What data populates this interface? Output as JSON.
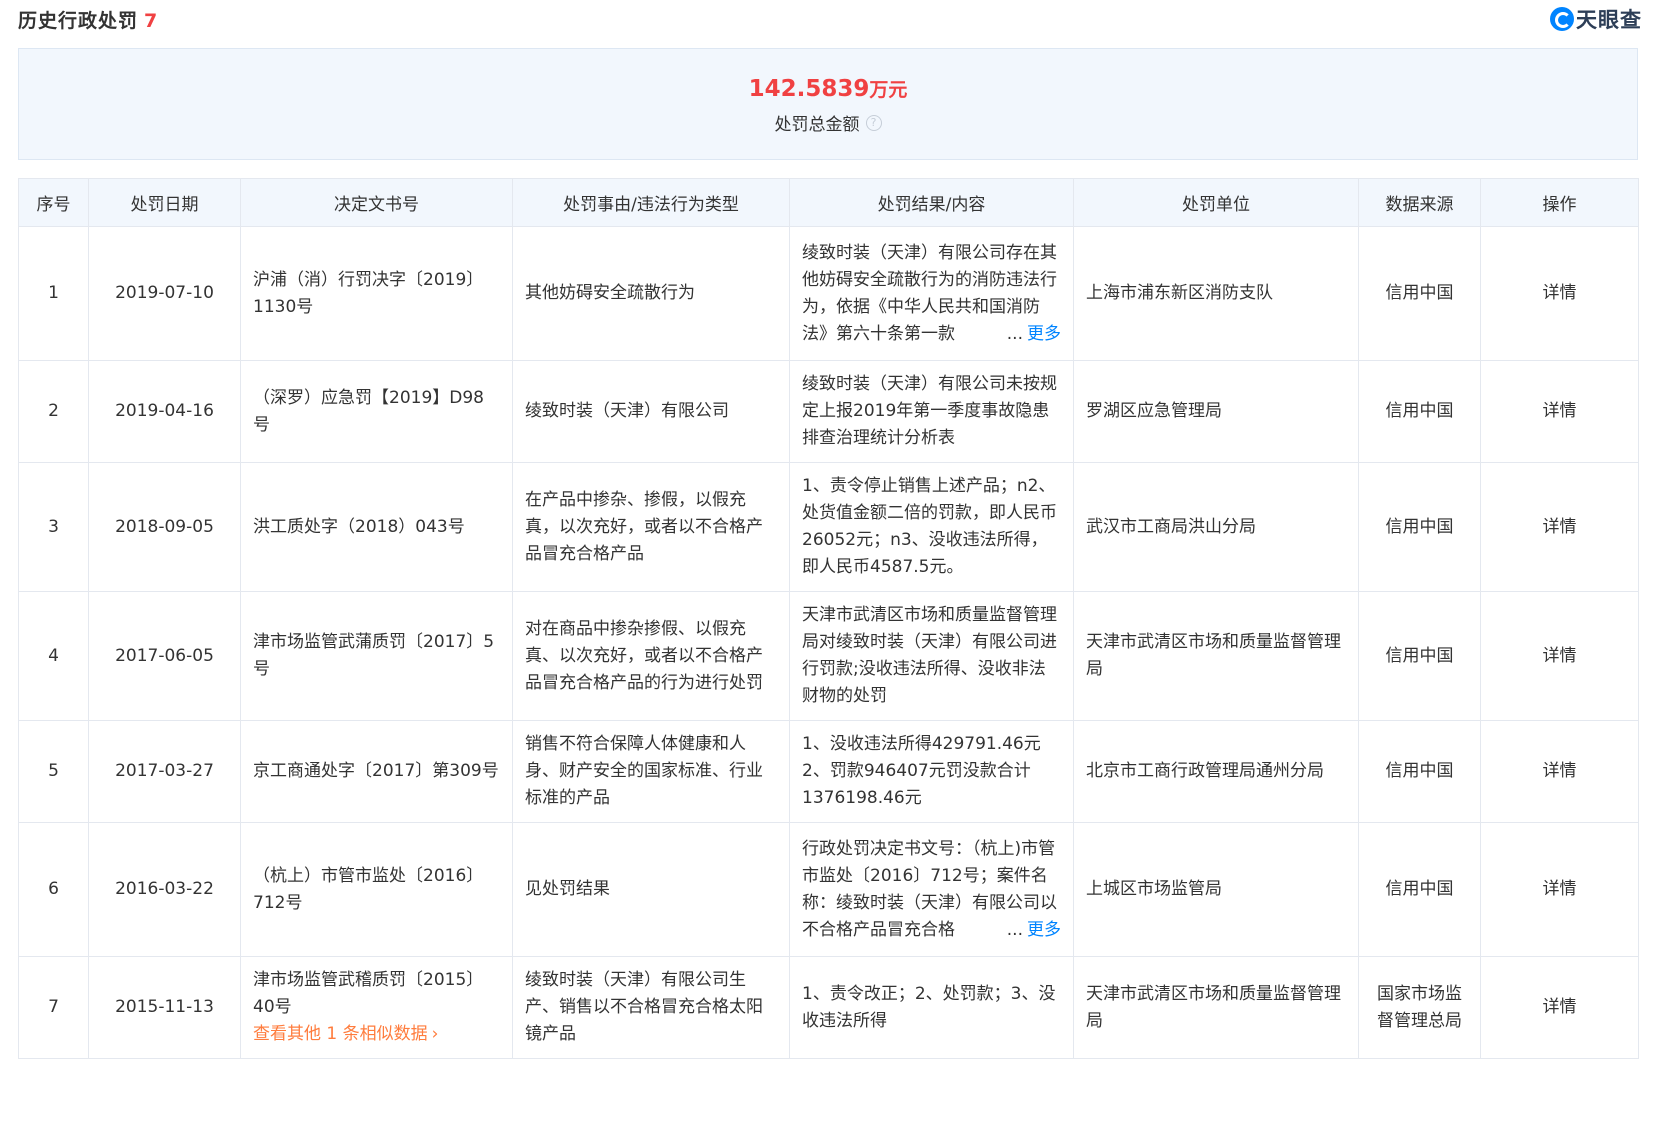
{
  "header": {
    "title": "历史行政处罚",
    "count": "7",
    "logo_text": "天眼查"
  },
  "summary": {
    "amount": "142.5839",
    "unit": "万元",
    "label": "处罚总金额",
    "help_icon": "?"
  },
  "table": {
    "columns": [
      "序号",
      "处罚日期",
      "决定文书号",
      "处罚事由/违法行为类型",
      "处罚结果/内容",
      "处罚单位",
      "数据来源",
      "操作"
    ],
    "rows": [
      {
        "index": "1",
        "date": "2019-07-10",
        "doc": "沪浦（消）行罚决字〔2019〕1130号",
        "reason": "其他妨碍安全疏散行为",
        "result": "绫致时装（天津）有限公司存在其他妨碍安全疏散行为的消防违法行为，依据《中华人民共和国消防法》第六十条第一款",
        "result_more": "更多",
        "org": "上海市浦东新区消防支队",
        "source": "信用中国",
        "action": "详情"
      },
      {
        "index": "2",
        "date": "2019-04-16",
        "doc": "（深罗）应急罚【2019】D98号",
        "reason": "绫致时装（天津）有限公司",
        "result": "绫致时装（天津）有限公司未按规定上报2019年第一季度事故隐患排查治理统计分析表",
        "result_more": "",
        "org": "罗湖区应急管理局",
        "source": "信用中国",
        "action": "详情"
      },
      {
        "index": "3",
        "date": "2018-09-05",
        "doc": "洪工质处字（2018）043号",
        "reason": "在产品中掺杂、掺假，以假充真，以次充好，或者以不合格产品冒充合格产品",
        "result": "1、责令停止销售上述产品；n2、处货值金额二倍的罚款，即人民币26052元；n3、没收违法所得，即人民币4587.5元。",
        "result_more": "",
        "org": "武汉市工商局洪山分局",
        "source": "信用中国",
        "action": "详情"
      },
      {
        "index": "4",
        "date": "2017-06-05",
        "doc": "津市场监管武蒲质罚〔2017〕5号",
        "reason": "对在商品中掺杂掺假、以假充真、以次充好，或者以不合格产品冒充合格产品的行为进行处罚",
        "result": "天津市武清区市场和质量监督管理局对绫致时装（天津）有限公司进行罚款;没收违法所得、没收非法财物的处罚",
        "result_more": "",
        "org": "天津市武清区市场和质量监督管理局",
        "source": "信用中国",
        "action": "详情"
      },
      {
        "index": "5",
        "date": "2017-03-27",
        "doc": "京工商通处字〔2017〕第309号",
        "reason": "销售不符合保障人体健康和人身、财产安全的国家标准、行业标准的产品",
        "result": "1、没收违法所得429791.46元 2、罚款946407元罚没款合计1376198.46元",
        "result_more": "",
        "org": "北京市工商行政管理局通州分局",
        "source": "信用中国",
        "action": "详情"
      },
      {
        "index": "6",
        "date": "2016-03-22",
        "doc": "（杭上）市管市监处〔2016〕712号",
        "reason": "见处罚结果",
        "result": "行政处罚决定书文号：（杭上)市管市监处〔2016〕712号；案件名称：绫致时装（天津）有限公司以不合格产品冒充合格",
        "result_more": "更多",
        "org": "上城区市场监管局",
        "source": "信用中国",
        "action": "详情"
      },
      {
        "index": "7",
        "date": "2015-11-13",
        "doc": "津市场监管武稽质罚〔2015〕40号",
        "doc_similar": "查看其他 1 条相似数据",
        "reason": "绫致时装（天津）有限公司生产、销售以不合格冒充合格太阳镜产品",
        "result": "1、责令改正；2、处罚款；3、没收违法所得",
        "result_more": "",
        "org": "天津市武清区市场和质量监督管理局",
        "source": "国家市场监督管理总局",
        "action": "详情"
      }
    ]
  },
  "icons": {
    "logo": "tianyancha-logo-icon",
    "help": "question-circle-icon",
    "chevron": "chevron-right-icon"
  },
  "colors": {
    "accent": "#f04142",
    "link": "#0084ff",
    "similar": "#ff7c3d",
    "summary_bg": "#f2f7fd",
    "border": "#e4e8ef"
  }
}
